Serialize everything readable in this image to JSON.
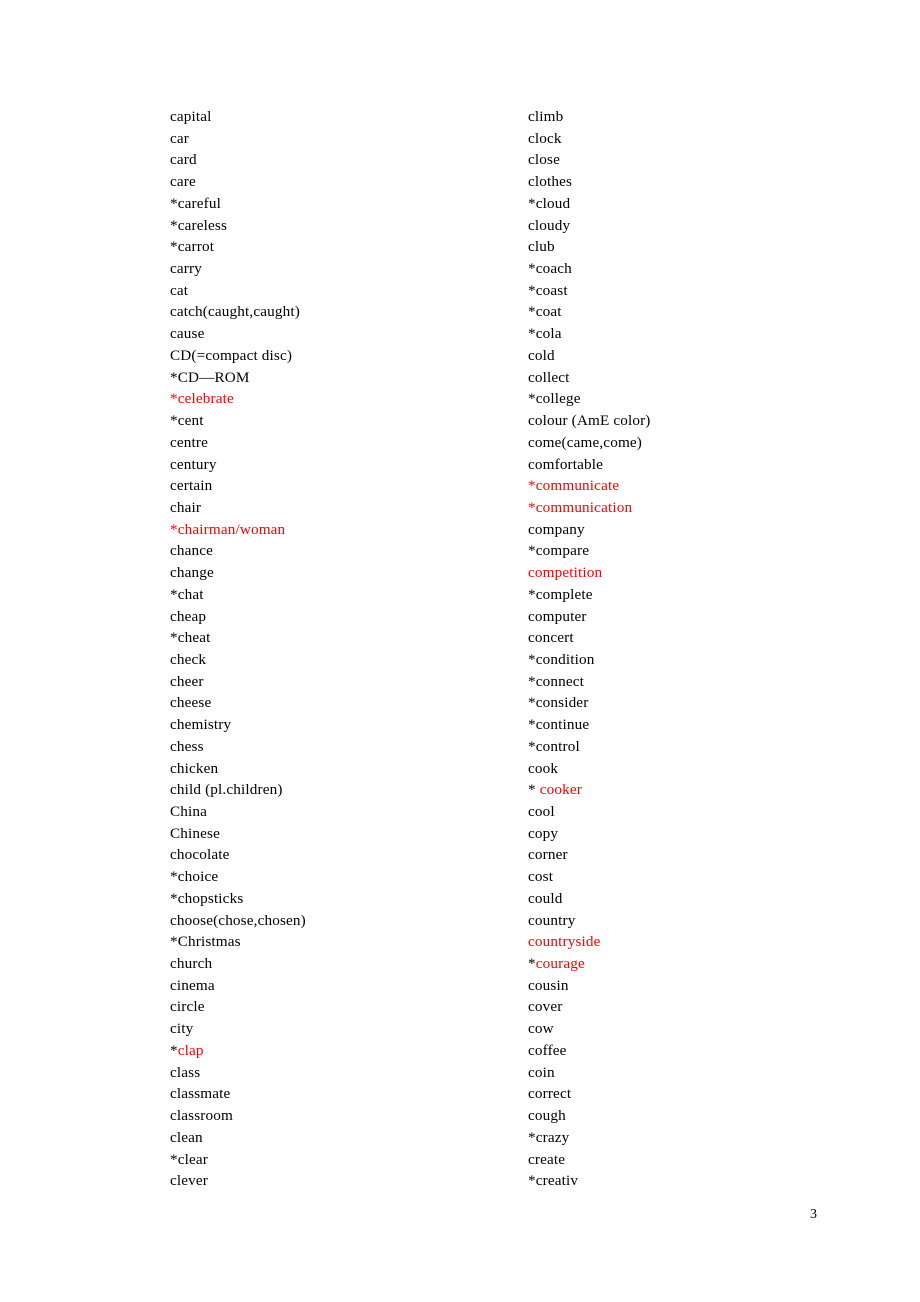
{
  "document": {
    "page_number": "3",
    "accent_red": "#ff0000",
    "text_color": "#000000"
  },
  "columns": {
    "left": [
      {
        "text": "capital",
        "color": "black"
      },
      {
        "text": "car",
        "color": "black"
      },
      {
        "text": "card",
        "color": "black"
      },
      {
        "text": "care",
        "color": "black"
      },
      {
        "text": "*careful",
        "color": "black"
      },
      {
        "text": "*careless",
        "color": "black"
      },
      {
        "text": "*carrot",
        "color": "black"
      },
      {
        "text": "carry",
        "color": "black"
      },
      {
        "text": "cat",
        "color": "black"
      },
      {
        "text": "catch(caught,caught)",
        "color": "black"
      },
      {
        "text": "cause",
        "color": "black"
      },
      {
        "text": "CD(=compact disc)",
        "color": "black"
      },
      {
        "text": "*CD—ROM",
        "color": "black"
      },
      {
        "text": "*celebrate",
        "color": "red"
      },
      {
        "text": "*cent",
        "color": "black"
      },
      {
        "text": "centre",
        "color": "black"
      },
      {
        "text": "century",
        "color": "black"
      },
      {
        "text": "certain",
        "color": "black"
      },
      {
        "text": "chair",
        "color": "black"
      },
      {
        "text": "*chairman/woman",
        "color": "red"
      },
      {
        "text": "chance",
        "color": "black"
      },
      {
        "text": "change",
        "color": "black"
      },
      {
        "text": "*chat",
        "color": "black"
      },
      {
        "text": "cheap",
        "color": "black"
      },
      {
        "text": "*cheat",
        "color": "black"
      },
      {
        "text": "check",
        "color": "black"
      },
      {
        "text": "cheer",
        "color": "black"
      },
      {
        "text": "cheese",
        "color": "black"
      },
      {
        "text": "chemistry",
        "color": "black"
      },
      {
        "text": "chess",
        "color": "black"
      },
      {
        "text": "chicken",
        "color": "black"
      },
      {
        "text": "child (pl.children)",
        "color": "black"
      },
      {
        "text": "China",
        "color": "black"
      },
      {
        "text": "Chinese",
        "color": "black"
      },
      {
        "text": "chocolate",
        "color": "black"
      },
      {
        "text": "*choice",
        "color": "black"
      },
      {
        "text": "*chopsticks",
        "color": "black"
      },
      {
        "text": "choose(chose,chosen)",
        "color": "black"
      },
      {
        "text": "*Christmas",
        "color": "black"
      },
      {
        "text": "church",
        "color": "black"
      },
      {
        "text": "cinema",
        "color": "black"
      },
      {
        "text": "circle",
        "color": "black"
      },
      {
        "text": "city",
        "color": "black"
      },
      {
        "text": "*clap",
        "color": "mixed",
        "prefix": "*",
        "word": "clap"
      },
      {
        "text": "class",
        "color": "black"
      },
      {
        "text": "classmate",
        "color": "black"
      },
      {
        "text": "classroom",
        "color": "black"
      },
      {
        "text": "clean",
        "color": "black"
      },
      {
        "text": "*clear",
        "color": "black"
      },
      {
        "text": "clever",
        "color": "black"
      }
    ],
    "right": [
      {
        "text": "climb",
        "color": "black"
      },
      {
        "text": "clock",
        "color": "black"
      },
      {
        "text": "close",
        "color": "black"
      },
      {
        "text": "clothes",
        "color": "black"
      },
      {
        "text": "*cloud",
        "color": "black"
      },
      {
        "text": "cloudy",
        "color": "black"
      },
      {
        "text": "club",
        "color": "black"
      },
      {
        "text": "*coach",
        "color": "black"
      },
      {
        "text": "*coast",
        "color": "black"
      },
      {
        "text": "*coat",
        "color": "black"
      },
      {
        "text": "*cola",
        "color": "black"
      },
      {
        "text": "cold",
        "color": "black"
      },
      {
        "text": "collect",
        "color": "black"
      },
      {
        "text": "*college",
        "color": "black"
      },
      {
        "text": "colour (AmE color)",
        "color": "black"
      },
      {
        "text": "come(came,come)",
        "color": "black"
      },
      {
        "text": "comfortable",
        "color": "black"
      },
      {
        "text": "*communicate",
        "color": "red"
      },
      {
        "text": "*communication",
        "color": "red"
      },
      {
        "text": "company",
        "color": "black"
      },
      {
        "text": "*compare",
        "color": "black"
      },
      {
        "text": "competition",
        "color": "red"
      },
      {
        "text": "*complete",
        "color": "black"
      },
      {
        "text": "computer",
        "color": "black"
      },
      {
        "text": "concert",
        "color": "black"
      },
      {
        "text": "*condition",
        "color": "black"
      },
      {
        "text": "*connect",
        "color": "black"
      },
      {
        "text": "*consider",
        "color": "black"
      },
      {
        "text": "*continue",
        "color": "black"
      },
      {
        "text": "*control",
        "color": "black"
      },
      {
        "text": "cook",
        "color": "black"
      },
      {
        "text": "* cooker",
        "color": "mixed",
        "prefix": "* ",
        "word": "cooker"
      },
      {
        "text": "cool",
        "color": "black"
      },
      {
        "text": "copy",
        "color": "black"
      },
      {
        "text": "corner",
        "color": "black"
      },
      {
        "text": "cost",
        "color": "black"
      },
      {
        "text": "could",
        "color": "black"
      },
      {
        "text": "country",
        "color": "black"
      },
      {
        "text": "countryside",
        "color": "red"
      },
      {
        "text": "*courage",
        "color": "mixed",
        "prefix": "*",
        "word": "courage"
      },
      {
        "text": "cousin",
        "color": "black"
      },
      {
        "text": "cover",
        "color": "black"
      },
      {
        "text": "cow",
        "color": "black"
      },
      {
        "text": "coffee",
        "color": "black"
      },
      {
        "text": "coin",
        "color": "black"
      },
      {
        "text": "correct",
        "color": "black"
      },
      {
        "text": "cough",
        "color": "black"
      },
      {
        "text": "*crazy",
        "color": "black"
      },
      {
        "text": "create",
        "color": "black"
      },
      {
        "text": "*creativ",
        "color": "black"
      }
    ]
  }
}
